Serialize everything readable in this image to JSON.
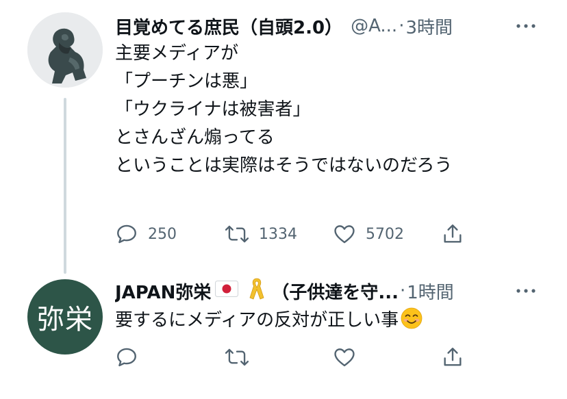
{
  "tweets": [
    {
      "display_name": "目覚めてる庶民（自頭2.0）",
      "handle": "@A...",
      "separator": "·",
      "time": "3時間",
      "lines": [
        "主要メディアが",
        "「プーチンは悪」",
        "「ウクライナは被害者」",
        "とさんざん煽ってる",
        "",
        "ということは実際はそうではないのだろう"
      ],
      "reply_count": "250",
      "retweet_count": "1334",
      "like_count": "5702"
    },
    {
      "display_name": "JAPAN弥栄",
      "display_name_suffix": "（子供達を守...",
      "separator": "·",
      "time": "1時間",
      "avatar_text": "弥栄",
      "text": "要するにメディアの反対が正しい事",
      "reply_count": "",
      "retweet_count": "",
      "like_count": ""
    }
  ],
  "colors": {
    "text": "#0f1419",
    "secondary": "#536471",
    "thread_line": "#cfd9de",
    "avatar2_bg": "#2d5548"
  },
  "icons": [
    "more-icon",
    "reply-icon",
    "retweet-icon",
    "like-icon",
    "share-icon",
    "japan-flag-icon",
    "yellow-ribbon-icon",
    "smiling-face-icon"
  ]
}
